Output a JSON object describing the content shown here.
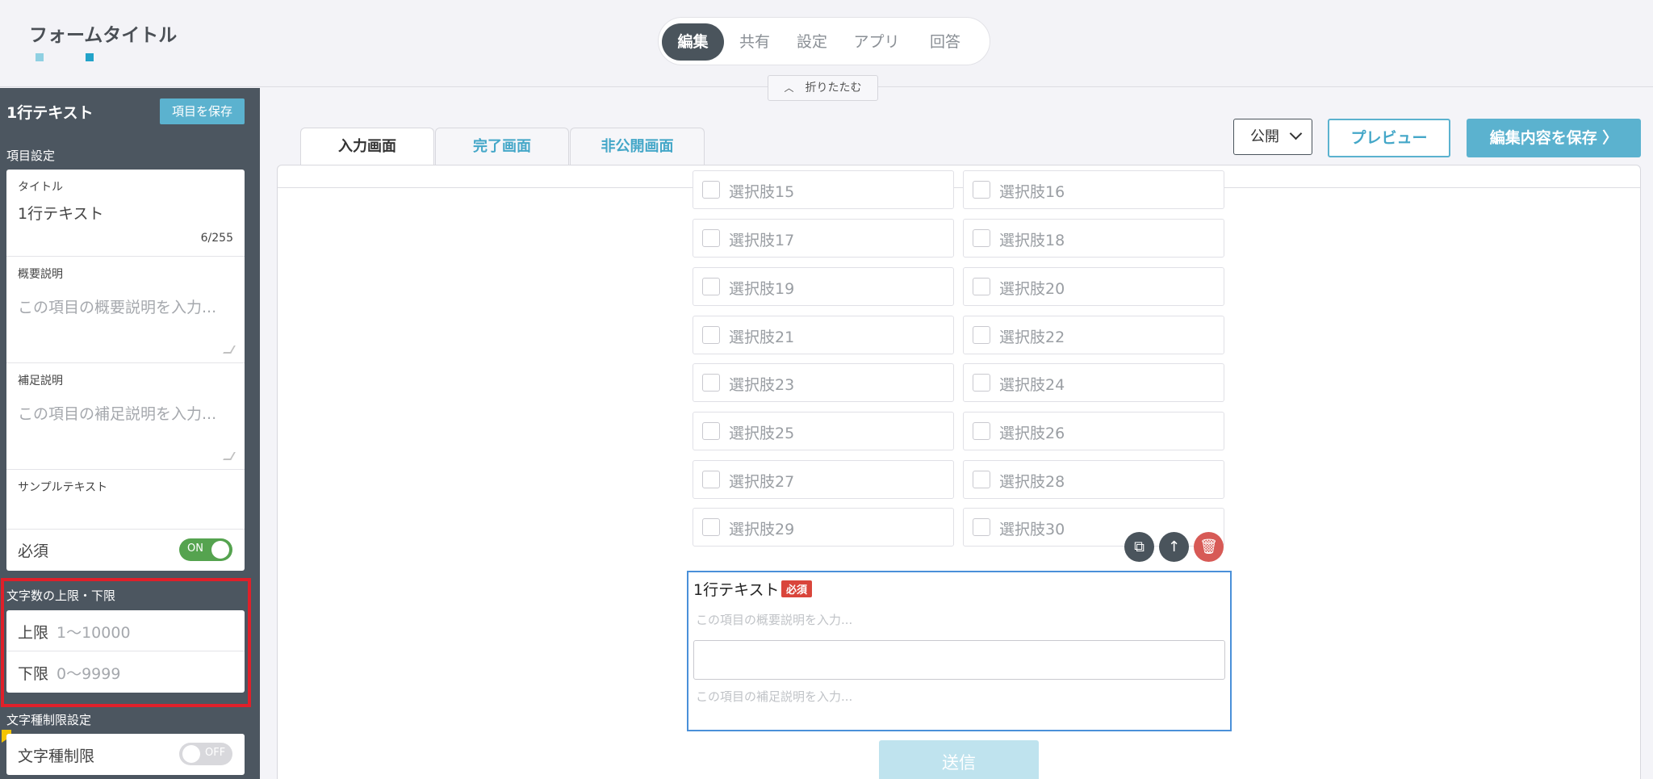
{
  "header": {
    "form_title": "フォームタイトル",
    "nav": [
      {
        "label": "編集",
        "active": true
      },
      {
        "label": "共有"
      },
      {
        "label": "設定"
      },
      {
        "label": "アプリ"
      },
      {
        "label": "回答"
      }
    ],
    "collapse_label": "折りたたむ"
  },
  "sidebar": {
    "title": "1行テキスト",
    "save_label": "項目を保存",
    "item_settings_label": "項目設定",
    "title_field": {
      "label": "タイトル",
      "value": "1行テキスト",
      "counter": "6/255"
    },
    "summary_field": {
      "label": "概要説明",
      "placeholder": "この項目の概要説明を入力..."
    },
    "note_field": {
      "label": "補足説明",
      "placeholder": "この項目の補足説明を入力..."
    },
    "sample_field": {
      "label": "サンプルテキスト"
    },
    "required": {
      "label": "必須",
      "toggle": "ON"
    },
    "char_limit_section": "文字数の上限・下限",
    "upper": {
      "label": "上限",
      "placeholder": "1〜10000"
    },
    "lower": {
      "label": "下限",
      "placeholder": "0〜9999"
    },
    "char_type_section": "文字種制限設定",
    "char_type": {
      "label": "文字種制限",
      "toggle": "OFF"
    }
  },
  "main": {
    "tabs": [
      {
        "label": "入力画面",
        "active": true
      },
      {
        "label": "完了画面"
      },
      {
        "label": "非公開画面"
      }
    ],
    "status": "公開",
    "preview_label": "プレビュー",
    "save_label": "編集内容を保存 〉",
    "choices": [
      "選択肢15",
      "選択肢16",
      "選択肢17",
      "選択肢18",
      "選択肢19",
      "選択肢20",
      "選択肢21",
      "選択肢22",
      "選択肢23",
      "選択肢24",
      "選択肢25",
      "選択肢26",
      "選択肢27",
      "選択肢28",
      "選択肢29",
      "選択肢30"
    ],
    "selected_field": {
      "title": "1行テキスト",
      "required_badge": "必須",
      "desc_placeholder": "この項目の概要説明を入力...",
      "note_placeholder": "この項目の補足説明を入力..."
    },
    "submit_label": "送信"
  },
  "colors": {
    "accent": "#5bb2cf",
    "sidebar": "#4c5660",
    "required": "#d9453b",
    "on": "#55a34f",
    "highlight": "#e0202a"
  }
}
